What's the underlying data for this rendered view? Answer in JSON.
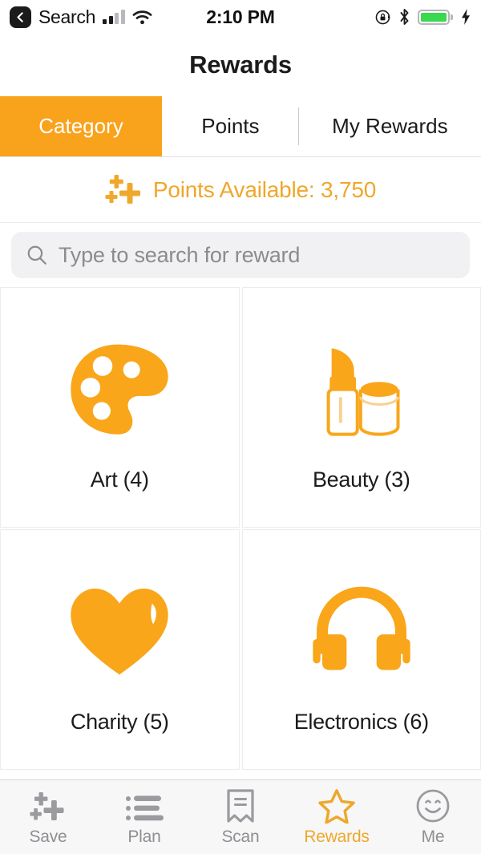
{
  "status_bar": {
    "back_label": "Search",
    "back_icon": "chevron-left-icon",
    "signal_icon": "cellular-signal-icon",
    "wifi_icon": "wifi-icon",
    "time": "2:10 PM",
    "rotation_lock_icon": "rotation-lock-icon",
    "bluetooth_icon": "bluetooth-icon",
    "battery_icon": "battery-charging-icon",
    "battery_color": "#3ad84e",
    "charging_icon": "lightning-bolt-icon"
  },
  "header": {
    "title": "Rewards"
  },
  "tabs": {
    "active_index": 0,
    "items": [
      {
        "label": "Category"
      },
      {
        "label": "Points"
      },
      {
        "label": "My Rewards"
      }
    ],
    "active_bg": "#F9A21B",
    "active_fg": "#ffffff"
  },
  "points": {
    "icon": "points-sparkle-icon",
    "text": "Points Available: 3,750",
    "value": "3,750",
    "color": "#EFA72B"
  },
  "search": {
    "icon": "search-icon",
    "placeholder": "Type to search for reward",
    "value": ""
  },
  "categories": [
    {
      "icon": "palette-icon",
      "label": "Art (4)",
      "count": 4
    },
    {
      "icon": "lipstick-icon",
      "label": "Beauty (3)",
      "count": 3
    },
    {
      "icon": "heart-icon",
      "label": "Charity (5)",
      "count": 5
    },
    {
      "icon": "headphones-icon",
      "label": "Electronics (6)",
      "count": 6
    }
  ],
  "bottom_nav": {
    "active_index": 3,
    "active_color": "#EFA72B",
    "inactive_color": "#8e8e93",
    "items": [
      {
        "label": "Save",
        "icon": "sparkle-plus-icon"
      },
      {
        "label": "Plan",
        "icon": "bullet-list-icon"
      },
      {
        "label": "Scan",
        "icon": "receipt-icon"
      },
      {
        "label": "Rewards",
        "icon": "star-icon"
      },
      {
        "label": "Me",
        "icon": "smiley-face-icon"
      }
    ]
  },
  "theme": {
    "orange": "#F9A21B",
    "gold": "#EFA72B",
    "text": "#1b1b1b",
    "muted": "#8e8e93"
  }
}
